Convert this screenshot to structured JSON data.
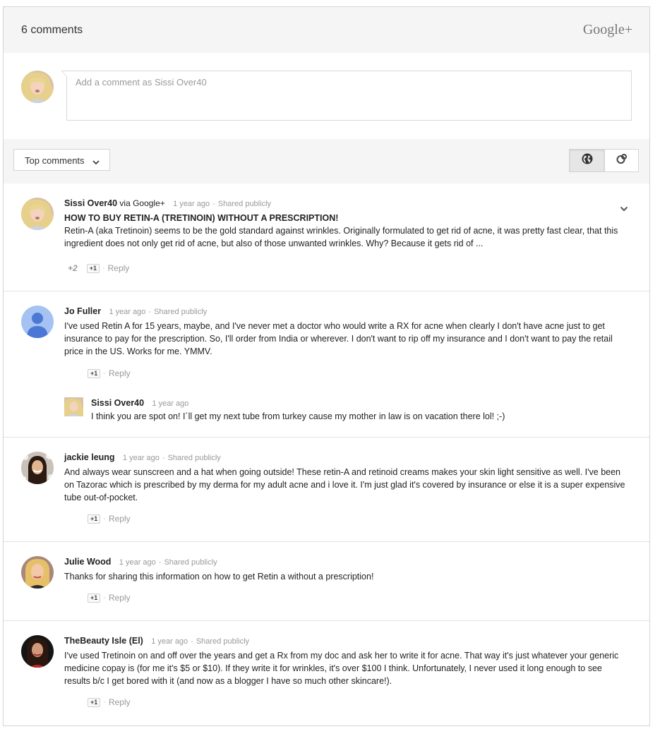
{
  "header": {
    "count_label": "6 comments",
    "brand": "Google+"
  },
  "compose": {
    "placeholder": "Add a comment as Sissi Over40"
  },
  "toolbar": {
    "sort_label": "Top comments",
    "icons": [
      "globe-icon",
      "circles-icon"
    ]
  },
  "colors": {
    "header_bg": "#f5f5f5",
    "meta_gray": "#999999",
    "border": "#d4d4d4"
  },
  "comments": [
    {
      "author": "Sissi Over40",
      "via": "via Google+",
      "time": "1 year ago",
      "shared": "Shared publicly",
      "headline": "HOW TO BUY RETIN-A (TRETINOIN) WITHOUT A PRESCRIPTION!",
      "text": "Retin-A (aka Tretinoin) seems to be the gold standard against wrinkles. Originally formulated to get rid of acne, it was pretty fast clear, that this ingredient does not only get rid of acne, but also of those unwanted wrinkles. Why? Because it gets rid of ...",
      "plus_count": "+2",
      "plusone": "+1",
      "reply": "Reply"
    },
    {
      "author": "Jo Fuller",
      "time": "1 year ago",
      "shared": "Shared publicly",
      "text": "I've used Retin A for 15 years, maybe, and I've never met a doctor who would write a RX for acne when clearly I don't have acne just to get insurance to pay for the prescription. So, I'll order from India or wherever. I don't want to rip off my insurance and I don't want to pay the retail price in the US. Works for me. YMMV.",
      "plusone": "+1",
      "reply": "Reply",
      "replies": [
        {
          "author": "Sissi Over40",
          "time": "1 year ago",
          "text": "I think you are spot on! I´ll get my next tube from turkey cause my mother in law is on vacation there lol! ;-)"
        }
      ]
    },
    {
      "author": "jackie leung",
      "time": "1 year ago",
      "shared": "Shared publicly",
      "text": "And always wear sunscreen and a hat when going outside! These retin-A and retinoid creams makes your skin light sensitive as well. I've been on Tazorac which is prescribed by my derma for my adult acne and i love it. I'm just glad it's covered by insurance or else it is a super expensive tube out-of-pocket.",
      "plusone": "+1",
      "reply": "Reply"
    },
    {
      "author": "Julie Wood",
      "time": "1 year ago",
      "shared": "Shared publicly",
      "text": "Thanks for sharing this information on how to get Retin a without a prescription!",
      "plusone": "+1",
      "reply": "Reply"
    },
    {
      "author": "TheBeauty Isle (El)",
      "time": "1 year ago",
      "shared": "Shared publicly",
      "text": "I've used Tretinoin on and off over the years and get a Rx from my doc and ask her to write it for acne. That way it's just whatever your generic medicine copay is (for me it's $5 or $10). If they write it for wrinkles, it's over $100 I think. Unfortunately, I never used it long enough to see results b/c I get bored with it (and now as a blogger I have so much other skincare!).",
      "plusone": "+1",
      "reply": "Reply"
    }
  ]
}
